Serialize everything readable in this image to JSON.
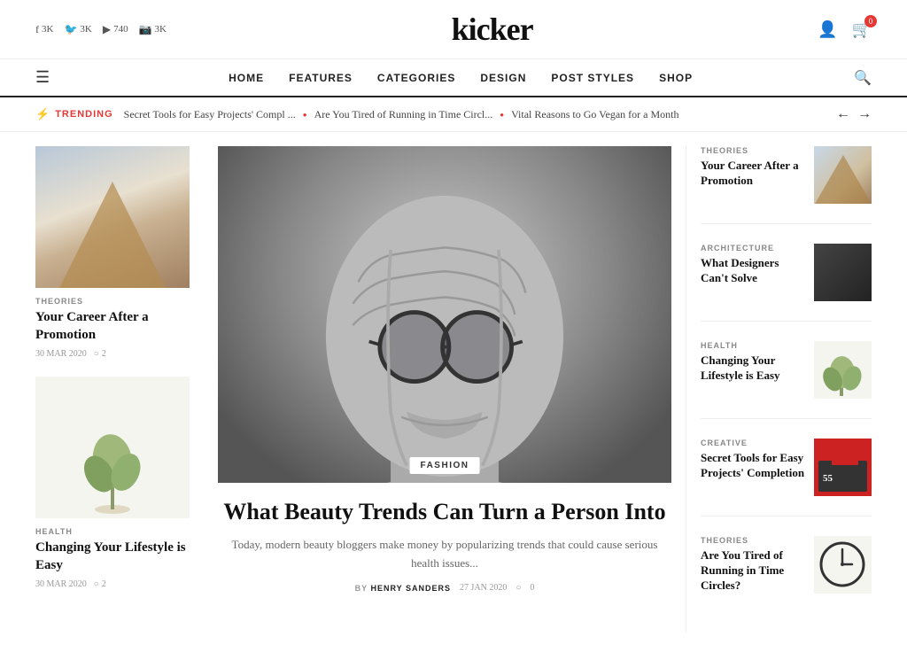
{
  "site": {
    "logo": "kicker"
  },
  "header": {
    "social": [
      {
        "icon": "f",
        "label": "3K",
        "id": "facebook"
      },
      {
        "icon": "🐦",
        "label": "3K",
        "id": "twitter"
      },
      {
        "icon": "▶",
        "label": "740",
        "id": "youtube"
      },
      {
        "icon": "📷",
        "label": "3K",
        "id": "instagram"
      }
    ],
    "user_icon": "👤",
    "cart_icon": "🛒",
    "cart_count": "0"
  },
  "nav": {
    "links": [
      "HOME",
      "FEATURES",
      "CATEGORIES",
      "DESIGN",
      "POST STYLES",
      "SHOP"
    ]
  },
  "trending": {
    "label": "TRENDING",
    "items": [
      "Secret Tools for Easy Projects' Compl ...",
      "Are You Tired of Running in Time Circl...",
      "Vital Reasons to Go Vegan for a Month"
    ]
  },
  "left_articles": [
    {
      "category": "THEORIES",
      "title": "Your Career After a Promotion",
      "date": "30 MAR 2020",
      "comments": "2",
      "img_type": "architecture"
    },
    {
      "category": "HEALTH",
      "title": "Changing Your Lifestyle is Easy",
      "date": "30 MAR 2020",
      "comments": "2",
      "img_type": "plant"
    }
  ],
  "center_article": {
    "category": "FASHION",
    "title": "What Beauty Trends Can Turn a Person Into",
    "description": "Today, modern beauty bloggers make money by popularizing trends that could cause serious health issues...",
    "author_label": "BY",
    "author": "HENRY SANDERS",
    "date": "27 JAN 2020",
    "comments": "0"
  },
  "right_articles": [
    {
      "category": "THEORIES",
      "title": "Your Career After a Promotion",
      "img_type": "arch-right"
    },
    {
      "category": "ARCHITECTURE",
      "title": "What Designers Can't Solve",
      "img_type": "dark"
    },
    {
      "category": "HEALTH",
      "title": "Changing Your Lifestyle is Easy",
      "img_type": "plant-small"
    },
    {
      "category": "CREATIVE",
      "title": "Secret Tools for Easy Projects' Completion",
      "img_type": "tools"
    },
    {
      "category": "THEORIES",
      "title": "Are You Tired of Running in Time Circles?",
      "img_type": "clock"
    }
  ]
}
